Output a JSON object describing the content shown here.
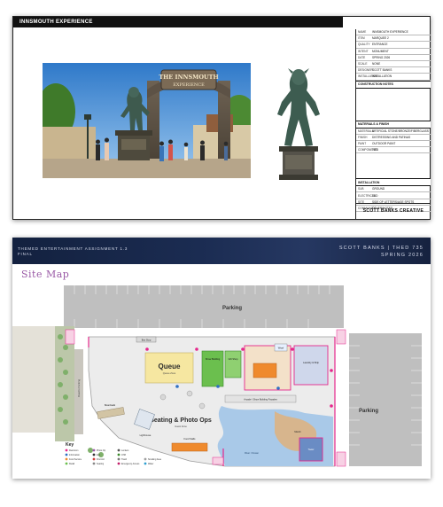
{
  "sheet1": {
    "title": "INNSMOUTH EXPERIENCE",
    "entrance_sign_line1": "THE INNSMOUTH",
    "entrance_sign_line2": "EXPERIENCE",
    "info_rows": [
      {
        "k": "NAME",
        "v": "INNSMOUTH EXPERIENCE"
      },
      {
        "k": "ITEM",
        "v": "MARQUEE 2"
      },
      {
        "k": "QUALITY",
        "v": "ENTRANCE"
      },
      {
        "k": "INTENT",
        "v": "MONUMENT"
      },
      {
        "k": "DATE",
        "v": "SPRING 2026"
      },
      {
        "k": "SCALE",
        "v": "NONE"
      },
      {
        "k": "DESIGNER",
        "v": "SCOTT BANKS"
      },
      {
        "k": "INSTALLATION",
        "v": "INSTALLATION"
      }
    ],
    "construction_heading": "CONSTRUCTION NOTES",
    "materials_heading": "MATERIALS & FINISH",
    "material_rows": [
      {
        "k": "MATERIALS",
        "v": "ARTIFICIAL STONE/BRONZE/FIBERGLASS"
      },
      {
        "k": "FINISH",
        "v": "DISTRESSING AND PATINAS"
      },
      {
        "k": "PAINT",
        "v": "OUTDOOR PAINT"
      },
      {
        "k": "COMPONENTS",
        "v": "TBD"
      }
    ],
    "installation_heading": "INSTALLATION",
    "install_rows": [
      {
        "k": "SUB",
        "v": "GROUND"
      },
      {
        "k": "ELECTRICAL",
        "v": "TBD"
      },
      {
        "k": "SITE",
        "v": "SIDE OF LETTERS/AGE SPOTS"
      },
      {
        "k": "COMMUNITY",
        "v": "OTHER/NOTES"
      }
    ],
    "creative": "SCOTT BANKS CREATIVE"
  },
  "sheet2": {
    "banner_left_line1": "THEMED ENTERTAINMENT ASSIGNMENT 1.3",
    "banner_left_line2": "FINAL",
    "banner_right_line1": "SCOTT BANKS | THED 735",
    "banner_right_line2": "SPRING 2026",
    "title": "Site Map",
    "parking_top": "Parking",
    "parking_right": "Parking",
    "queue": "Queue",
    "queue_sub": "Queue Zone",
    "seating": "Seating & Photo Ops",
    "seating_sub": "Guest Zone",
    "key_title": "Key",
    "labels": {
      "bus_stop": "Bus Stop",
      "show_building": "Show Building",
      "gift_shop": "Gift Shop",
      "arcade": "Arcade / Show Building Facades",
      "covered_bridge": "Covered Bridge",
      "lighthouse": "Lighthouse",
      "boardwalk": "Boardwalk",
      "wharf": "Wharf",
      "tower": "Tower",
      "food": "Food Stalls",
      "restrooms": "Restrooms",
      "laundry": "Laundry & Ship",
      "fish_market": "Fish Market",
      "crossing": "Crossing",
      "river": "River / Ocean",
      "marsh": "Marsh"
    },
    "key_items": [
      "Restroom",
      "Information",
      "Food Service",
      "Retail",
      "Photo Op",
      "Exit",
      "First Aid",
      "Seating",
      "Lockers",
      "ATM",
      "Trash",
      "Emergency Access",
      "Water",
      "Smoking Area"
    ],
    "colors": {
      "banner": "#1b2c52",
      "title": "#9a5aa6",
      "queue": "#f6e7a1",
      "green": "#6bbf4e",
      "orange": "#ef8a2d",
      "blue_water": "#a9c9e8",
      "magenta": "#e5278b",
      "parking": "#bdbdbd"
    }
  }
}
